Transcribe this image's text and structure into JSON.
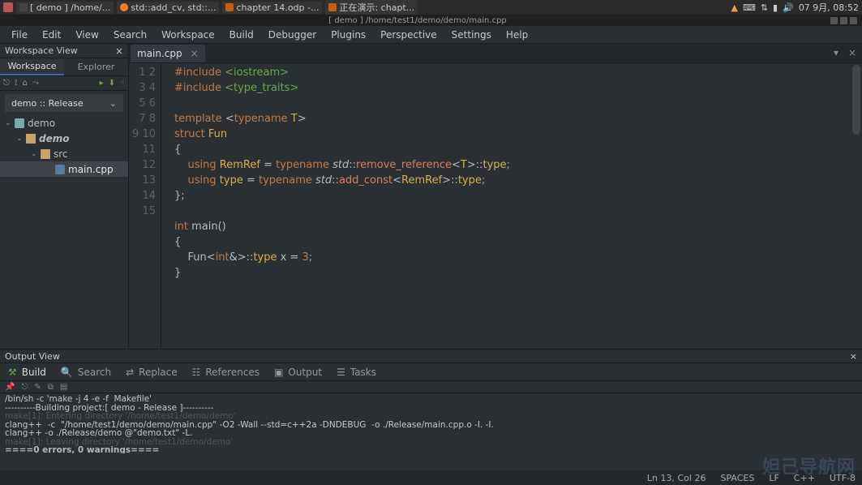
{
  "taskbar": {
    "items": [
      {
        "icon": "app",
        "label": "[ demo ] /home/..."
      },
      {
        "icon": "ff",
        "label": "std::add_cv, std::..."
      },
      {
        "icon": "lo",
        "label": "chapter 14.odp -..."
      },
      {
        "icon": "lo",
        "label": "正在演示: chapt..."
      }
    ],
    "clock": "07 9月, 08:52"
  },
  "title": "[ demo ] /home/test1/demo/demo/main.cpp",
  "menu": [
    "File",
    "Edit",
    "View",
    "Search",
    "Workspace",
    "Build",
    "Debugger",
    "Plugins",
    "Perspective",
    "Settings",
    "Help"
  ],
  "leftpanel": {
    "title": "Workspace View",
    "tabs": [
      "Workspace",
      "Explorer"
    ],
    "build_selector": "demo :: Release",
    "tree": {
      "workspace": "demo",
      "project": "demo",
      "folder": "src",
      "file": "main.cpp"
    }
  },
  "editor": {
    "tab": "main.cpp",
    "line_count": 15,
    "code": {
      "l1": {
        "a": "#include ",
        "b": "<iostream>"
      },
      "l2": {
        "a": "#include ",
        "b": "<type_traits>"
      },
      "l4": {
        "a": "template ",
        "b": "<",
        "c": "typename ",
        "d": "T",
        "e": ">"
      },
      "l5": {
        "a": "struct ",
        "b": "Fun"
      },
      "l6": "{",
      "l7": {
        "a": "    using ",
        "b": "RemRef ",
        "c": "= ",
        "d": "typename ",
        "e": "std",
        "f": "::",
        "g": "remove_reference",
        "h": "<",
        "i": "T",
        "j": ">::",
        "k": "type",
        "l": ";"
      },
      "l8": {
        "a": "    using ",
        "b": "type ",
        "c": "= ",
        "d": "typename ",
        "e": "std",
        "f": "::",
        "g": "add_const",
        "h": "<",
        "i": "RemRef",
        "j": ">::",
        "k": "type",
        "l": ";"
      },
      "l9": "};",
      "l11": {
        "a": "int ",
        "b": "main",
        "c": "()"
      },
      "l12": "{",
      "l13": {
        "a": "    Fun",
        "b": "<",
        "c": "int",
        "d": "&>::",
        "e": "type ",
        "f": "x ",
        "g": "= ",
        "h": "3",
        "i": ";"
      },
      "l14": "}"
    }
  },
  "output": {
    "title": "Output View",
    "tabs": [
      "Build",
      "Search",
      "Replace",
      "References",
      "Output",
      "Tasks"
    ],
    "lines": {
      "l1": "/bin/sh -c 'make -j 4 -e -f  Makefile'",
      "l2": "----------Building project:[ demo - Release ]----------",
      "l3": "make[1]: Entering directory '/home/test1/demo/demo'",
      "l4": "clang++  -c  \"/home/test1/demo/demo/main.cpp\" -O2 -Wall --std=c++2a -DNDEBUG  -o ./Release/main.cpp.o -I. -I.",
      "l5": "clang++ -o ./Release/demo @\"demo.txt\" -L.",
      "l6": "make[1]: Leaving directory '/home/test1/demo/demo'",
      "l7": "====0 errors, 0 warnings===="
    }
  },
  "status": {
    "pos": "Ln 13, Col 26",
    "spaces": "SPACES",
    "eol": "LF",
    "lang": "C++",
    "enc": "UTF-8"
  },
  "watermark": "妲己导航网"
}
